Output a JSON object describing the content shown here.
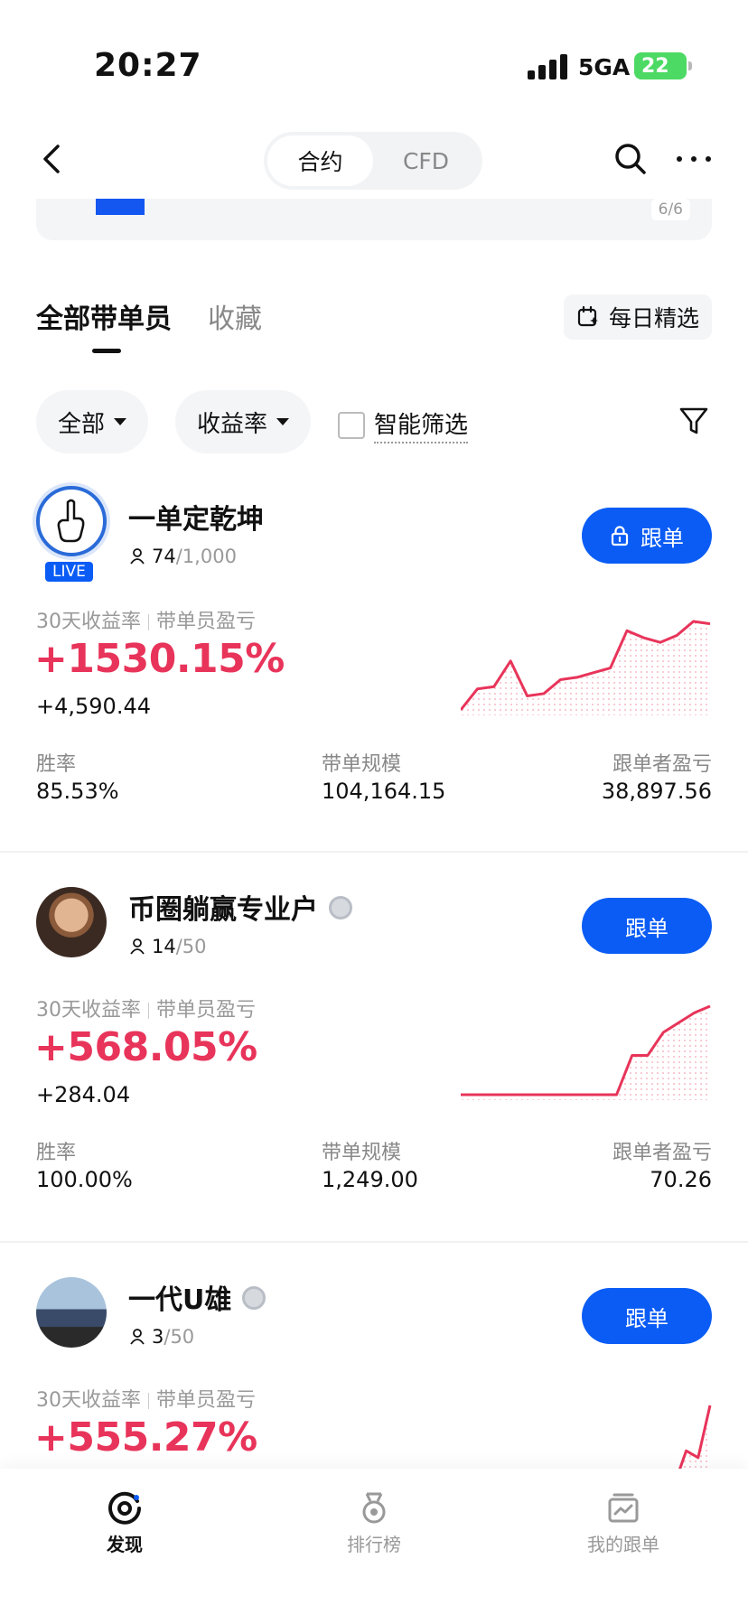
{
  "status_bar": {
    "time": "20:27",
    "network": "5GA",
    "battery": "22"
  },
  "nav": {
    "segments": [
      {
        "label": "合约",
        "active": true
      },
      {
        "label": "CFD",
        "active": false
      }
    ]
  },
  "banner": {
    "page_indicator": "6/6"
  },
  "tabs": {
    "all_traders": "全部带单员",
    "favorites": "收藏",
    "daily_pick": "每日精选"
  },
  "filters": {
    "scope": "全部",
    "sort": "收益率",
    "smart_filter": "智能筛选"
  },
  "card_labels": {
    "stat_head_left": "30天收益率",
    "stat_head_right": "带单员盈亏",
    "win_rate": "胜率",
    "scale": "带单规模",
    "follower_pnl": "跟单者盈亏",
    "follow": "跟单",
    "live": "LIVE"
  },
  "traders": [
    {
      "name": "一单定乾坤",
      "followers": "74",
      "max_followers": "/1,000",
      "roi": "+1530.15%",
      "pnl": "+4,590.44",
      "win_rate": "85.53%",
      "scale": "104,164.15",
      "follower_pnl": "38,897.56",
      "locked": true,
      "live": true,
      "chart": [
        2,
        20,
        22,
        44,
        14,
        16,
        28,
        30,
        34,
        38,
        70,
        64,
        60,
        66,
        78,
        76
      ]
    },
    {
      "name": "币圈躺赢专业户",
      "followers": "14",
      "max_followers": "/50",
      "roi": "+568.05%",
      "pnl": "+284.04",
      "win_rate": "100.00%",
      "scale": "1,249.00",
      "follower_pnl": "70.26",
      "medal": true,
      "chart": [
        2,
        2,
        2,
        2,
        2,
        2,
        2,
        2,
        2,
        2,
        2,
        26,
        26,
        40,
        46,
        52,
        56
      ]
    },
    {
      "name": "一代U雄",
      "followers": "3",
      "max_followers": "/50",
      "roi": "+555.27%",
      "medal": true,
      "chart": [
        2,
        20,
        10,
        40,
        34,
        80
      ]
    }
  ],
  "bottom_nav": [
    {
      "label": "发现",
      "icon": "discover-icon",
      "active": true
    },
    {
      "label": "排行榜",
      "icon": "ranking-medal-icon",
      "active": false
    },
    {
      "label": "我的跟单",
      "icon": "my-copy-trades-icon",
      "active": false
    }
  ],
  "colors": {
    "accent": "#0a5cf5",
    "profit": "#e8345a"
  }
}
